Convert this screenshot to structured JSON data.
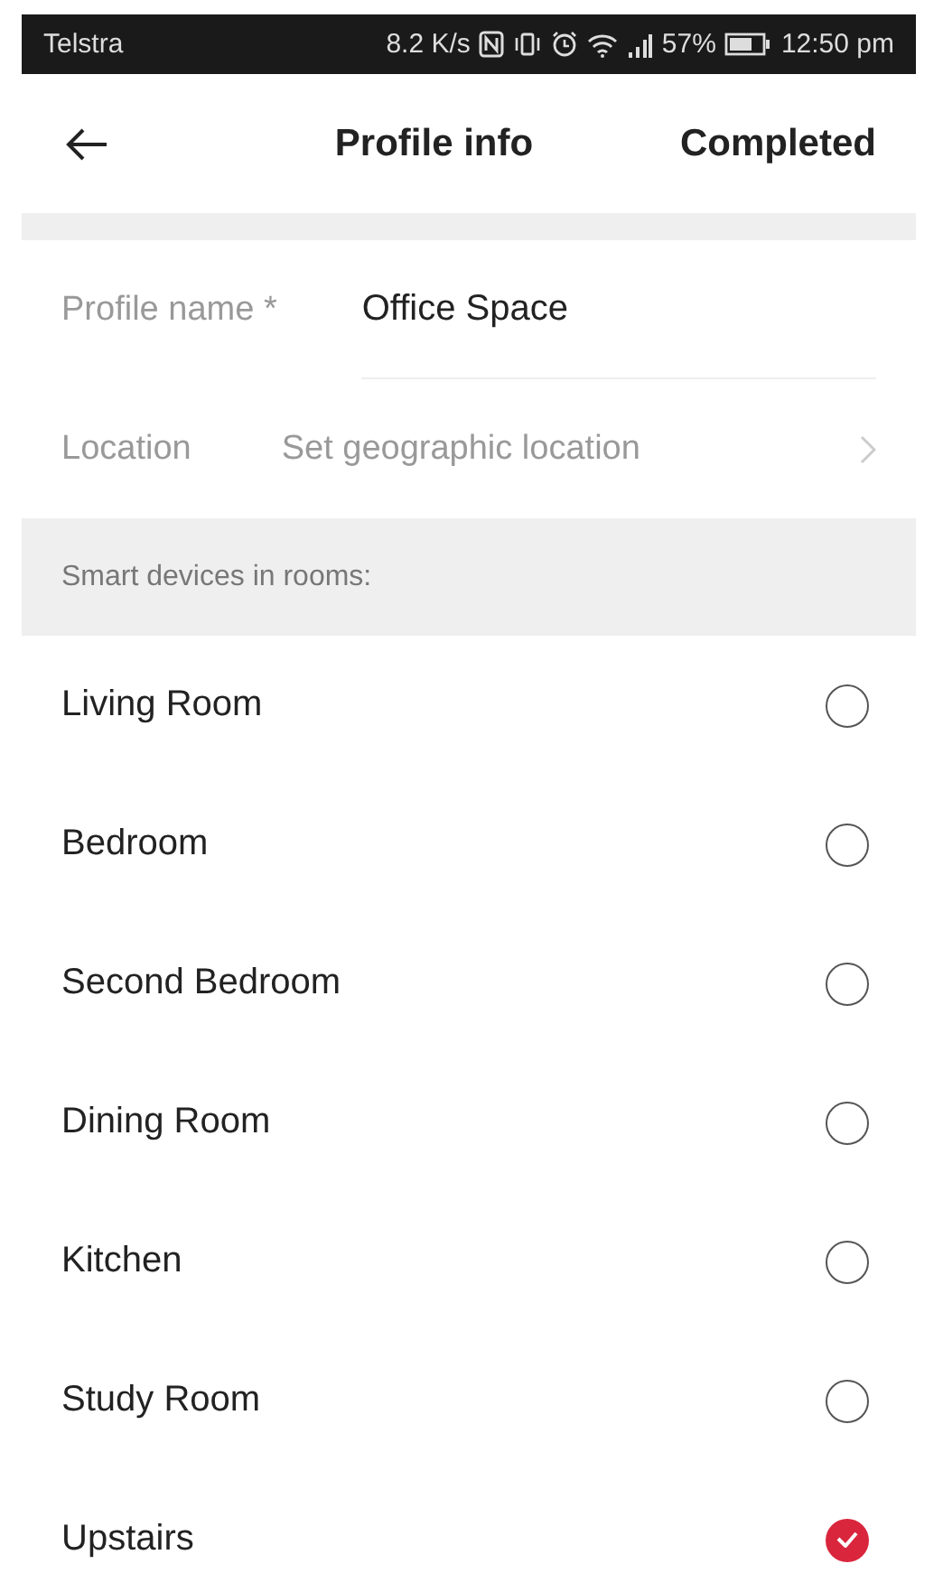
{
  "status_bar": {
    "carrier": "Telstra",
    "speed": "8.2 K/s",
    "battery": "57%",
    "time": "12:50 pm"
  },
  "header": {
    "title": "Profile info",
    "action": "Completed"
  },
  "form": {
    "profile_name": {
      "label": "Profile name *",
      "value": "Office Space"
    },
    "location": {
      "label": "Location",
      "placeholder": "Set geographic location"
    }
  },
  "section_title": "Smart devices in rooms:",
  "rooms": [
    {
      "name": "Living Room",
      "selected": false
    },
    {
      "name": "Bedroom",
      "selected": false
    },
    {
      "name": "Second Bedroom",
      "selected": false
    },
    {
      "name": "Dining Room",
      "selected": false
    },
    {
      "name": "Kitchen",
      "selected": false
    },
    {
      "name": "Study Room",
      "selected": false
    },
    {
      "name": "Upstairs",
      "selected": true
    }
  ]
}
